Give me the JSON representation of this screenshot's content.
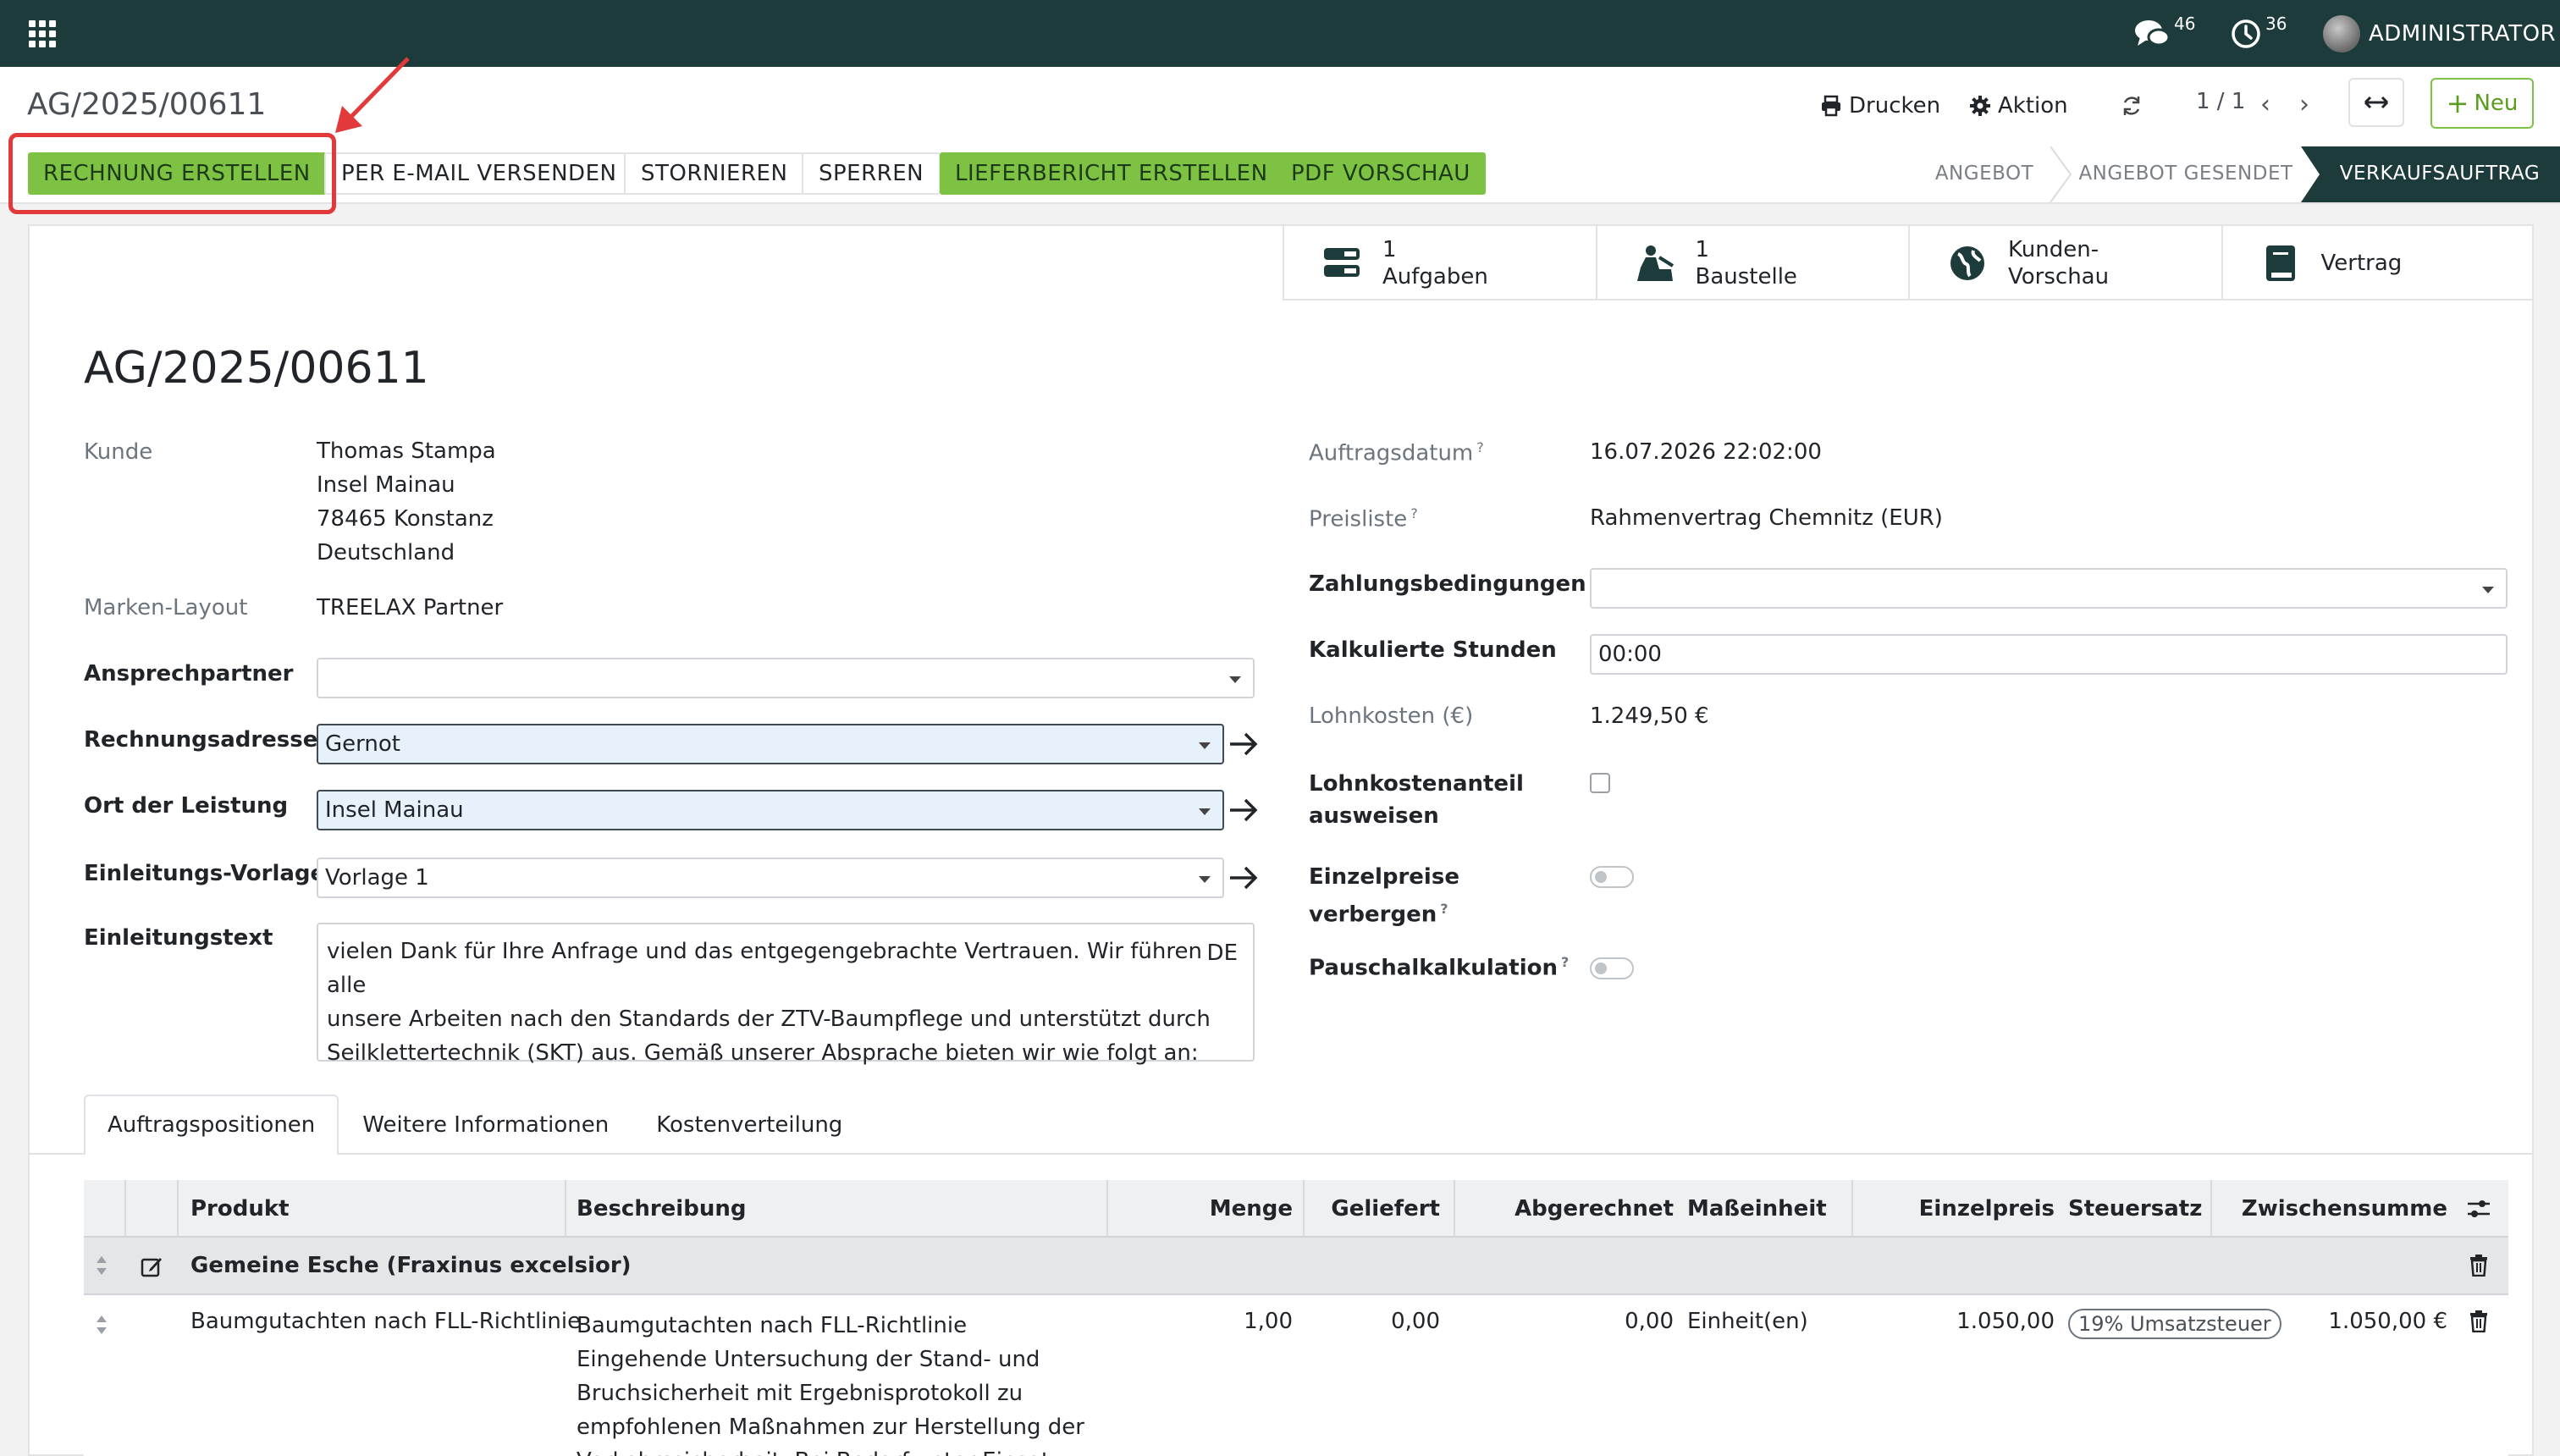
{
  "topbar": {
    "chat_count": "46",
    "activity_count": "36",
    "user_name": "ADMINISTRATOR"
  },
  "controlbar": {
    "breadcrumb": "AG/2025/00611",
    "print_label": "Drucken",
    "action_label": "Aktion",
    "pager": "1 / 1",
    "new_label": "Neu"
  },
  "actions": {
    "invoice": "RECHNUNG ERSTELLEN",
    "email": "PER E-MAIL VERSENDEN",
    "cancel": "STORNIEREN",
    "lock": "SPERREN",
    "delivery_report": "LIEFERBERICHT ERSTELLEN",
    "pdf_preview": "PDF VORSCHAU"
  },
  "stages": {
    "quotation": "ANGEBOT",
    "quotation_sent": "ANGEBOT GESENDET",
    "sales_order": "VERKAUFSAUFTRAG"
  },
  "smart_buttons": {
    "tasks_count": "1",
    "tasks_label": "Aufgaben",
    "site_count": "1",
    "site_label": "Baustelle",
    "portal_line1": "Kunden-",
    "portal_line2": "Vorschau",
    "contract_label": "Vertrag"
  },
  "form": {
    "title": "AG/2025/00611",
    "customer_label": "Kunde",
    "customer_name": "Thomas Stampa",
    "customer_street": "Insel Mainau",
    "customer_city": "78465 Konstanz",
    "customer_country": "Deutschland",
    "brand_label": "Marken-Layout",
    "brand_value": "TREELAX Partner",
    "contact_label": "Ansprechpartner",
    "contact_value": "",
    "invoice_address_label": "Rechnungsadresse",
    "invoice_address_value": "Gernot",
    "place_label": "Ort der Leistung",
    "place_value": "Insel Mainau",
    "intro_template_label": "Einleitungs-Vorlage",
    "intro_template_value": "Vorlage 1",
    "intro_text_label": "Einleitungstext",
    "intro_text_line1": "vielen Dank für Ihre Anfrage und das entgegengebrachte Vertrauen. Wir führen alle",
    "intro_text_line2": "unsere Arbeiten nach den Standards der ZTV-Baumpflege und unterstützt durch",
    "intro_text_line3": "Seilklettertechnik (SKT) aus. Gemäß unserer Absprache bieten wir wie folgt an:",
    "intro_lang": "DE",
    "order_date_label": "Auftragsdatum",
    "order_date_value": "16.07.2026 22:02:00",
    "pricelist_label": "Preisliste",
    "pricelist_value": "Rahmenvertrag Chemnitz (EUR)",
    "payment_terms_label": "Zahlungsbedingungen",
    "payment_terms_value": "",
    "hours_label": "Kalkulierte Stunden",
    "hours_value": "00:00",
    "labor_cost_label": "Lohnkosten (€)",
    "labor_cost_value": "1.249,50 €",
    "labor_share_label_1": "Lohnkostenanteil",
    "labor_share_label_2": "ausweisen",
    "hide_prices_label_1": "Einzelpreise",
    "hide_prices_label_2": "verbergen",
    "flat_calc_label": "Pauschalkalkulation",
    "help_mark": "?"
  },
  "tabs": [
    "Auftragspositionen",
    "Weitere Informationen",
    "Kostenverteilung"
  ],
  "table": {
    "headers": {
      "product": "Produkt",
      "description": "Beschreibung",
      "qty": "Menge",
      "delivered": "Geliefert",
      "invoiced": "Abgerechnet",
      "uom": "Maßeinheit",
      "unit_price": "Einzelpreis",
      "tax": "Steuersatz",
      "subtotal": "Zwischensumme"
    },
    "section_title": "Gemeine Esche (Fraxinus excelsior)",
    "row": {
      "product": "Baumgutachten nach FLL-Richtlinie",
      "desc_1": "Baumgutachten nach FLL-Richtlinie",
      "desc_2": "Eingehende Untersuchung der Stand- und",
      "desc_3": "Bruchsicherheit mit Ergebnisprotokoll zu",
      "desc_4": "empfohlenen Maßnahmen zur Herstellung der",
      "desc_5": "Verkehrssicherheit. Bei Bedarf unter Einsatz von",
      "qty": "1,00",
      "delivered": "0,00",
      "invoiced": "0,00",
      "uom": "Einheit(en)",
      "unit_price": "1.050,00",
      "tax": "19% Umsatzsteuer",
      "subtotal": "1.050,00 €"
    }
  },
  "colors": {
    "topbar": "#1d3b3a",
    "accent_green": "#7dc242",
    "highlight_red": "#e23a3a"
  }
}
